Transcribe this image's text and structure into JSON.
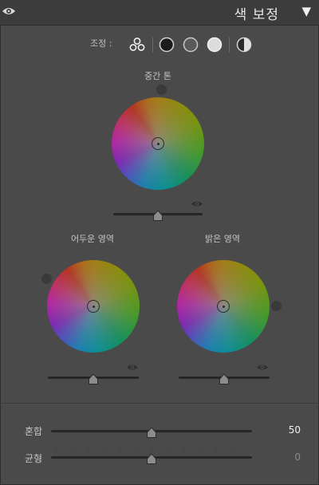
{
  "header": {
    "title": "색 보정"
  },
  "adjust": {
    "label": "조정 :"
  },
  "midtone": {
    "label": "중간 톤",
    "slider_value": 0.5
  },
  "shadows": {
    "label": "어두운 영역",
    "slider_value": 0.5
  },
  "highlights": {
    "label": "밝은 영역",
    "slider_value": 0.5
  },
  "blend": {
    "label": "혼합",
    "value": "50",
    "slider_value": 0.5
  },
  "balance": {
    "label": "균형",
    "value": "0",
    "slider_value": 0.5
  },
  "colors": {
    "value_bright": "#f0f0f0",
    "value_dim": "#8a8a8a"
  }
}
